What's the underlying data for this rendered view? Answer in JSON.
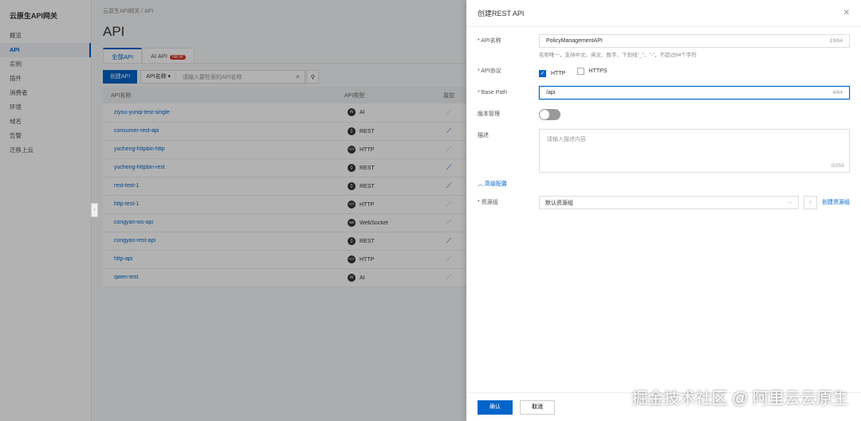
{
  "sidebar": {
    "title": "云原生API网关",
    "items": [
      "概览",
      "API",
      "实例",
      "插件",
      "消费者",
      "环境",
      "域名",
      "告警",
      "迁移上云"
    ]
  },
  "main": {
    "breadcrumb": [
      "云原生API网关",
      "API"
    ],
    "title": "API",
    "tabs": [
      {
        "label": "全部API"
      },
      {
        "label": "AI API",
        "badge": "NEW"
      }
    ],
    "create_button": "创建API",
    "search_select": "API名称",
    "search_placeholder": "请输入要检索的API名称",
    "columns": [
      "API名称",
      "API类型",
      "监控"
    ],
    "rows": [
      {
        "name": "ziyou-yunqi-test-single",
        "type": "AI",
        "icon": "AI",
        "monitor": false
      },
      {
        "name": "consumer-rest-api",
        "type": "REST",
        "icon": "{}",
        "monitor": true
      },
      {
        "name": "yucheng-httpbin-http",
        "type": "HTTP",
        "icon": "</>",
        "monitor": false
      },
      {
        "name": "yucheng-httpbin-rest",
        "type": "REST",
        "icon": "{}",
        "monitor": true
      },
      {
        "name": "rest-test-1",
        "type": "REST",
        "icon": "{}",
        "monitor": true
      },
      {
        "name": "http-test-1",
        "type": "HTTP",
        "icon": "</>",
        "monitor": false
      },
      {
        "name": "congyan-ws-api",
        "type": "WebSocket",
        "icon": "ws",
        "monitor": false
      },
      {
        "name": "congyan-rest-api",
        "type": "REST",
        "icon": "{}",
        "monitor": true
      },
      {
        "name": "http-api",
        "type": "HTTP",
        "icon": "</>",
        "monitor": false
      },
      {
        "name": "qwen-test",
        "type": "AI",
        "icon": "AI",
        "monitor": false
      }
    ]
  },
  "drawer": {
    "title": "创建REST API",
    "api_name": {
      "label": "* API名称",
      "value": "PolicyManagementAPI",
      "count": "19/64",
      "hint": "名称唯一，支持中文、英文、数字、下划线\"_\"、\"-\"，不超过64个字符"
    },
    "protocol": {
      "label": "* API协议",
      "options": [
        {
          "label": "HTTP",
          "checked": true
        },
        {
          "label": "HTTPS",
          "checked": false
        }
      ]
    },
    "base_path": {
      "label": "* Base Path",
      "value": "/api",
      "count": "4/64"
    },
    "version": {
      "label": "版本管理",
      "enabled": false
    },
    "description": {
      "label": "描述",
      "placeholder": "请输入描述内容",
      "count": "0/255"
    },
    "advanced": "高级配置",
    "resource_group": {
      "label": "* 资源组",
      "value": "默认资源组",
      "create_link": "创建资源组"
    },
    "confirm": "确认",
    "cancel": "取消"
  },
  "watermark": "掘金技术社区 @ 阿里云云原生",
  "colors": {
    "primary": "#0064c8",
    "badge": "#d93026"
  }
}
